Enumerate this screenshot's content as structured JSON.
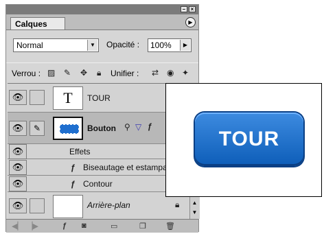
{
  "panel": {
    "tab_label": "Calques",
    "window_buttons": [
      "–",
      "×"
    ],
    "menu_arrow": "▶",
    "blend_mode": "Normal",
    "opacity_label": "Opacité :",
    "opacity_value": "100%",
    "lock_label": "Verrou :",
    "unify_label": "Unifier :"
  },
  "layers": [
    {
      "name": "TOUR",
      "type": "text",
      "thumb_glyph": "T",
      "visible": true
    },
    {
      "name": "Bouton",
      "type": "shape",
      "selected": true,
      "visible": true,
      "linked": true
    },
    {
      "name": "Effets",
      "type": "effects-header"
    },
    {
      "name": "Biseautage et estampage",
      "type": "effect",
      "icon_glyph": "ƒ"
    },
    {
      "name": "Contour",
      "type": "effect",
      "icon_glyph": "ƒ"
    },
    {
      "name": "Arrière-plan",
      "type": "background",
      "visible": true
    }
  ],
  "preview": {
    "button_text": "TOUR",
    "accent": "#0d5db8"
  },
  "icons": [
    "eye-icon",
    "brush-icon",
    "link-icon",
    "lock-icon",
    "fx-icon",
    "folder-icon",
    "new-layer-icon",
    "trash-icon"
  ]
}
